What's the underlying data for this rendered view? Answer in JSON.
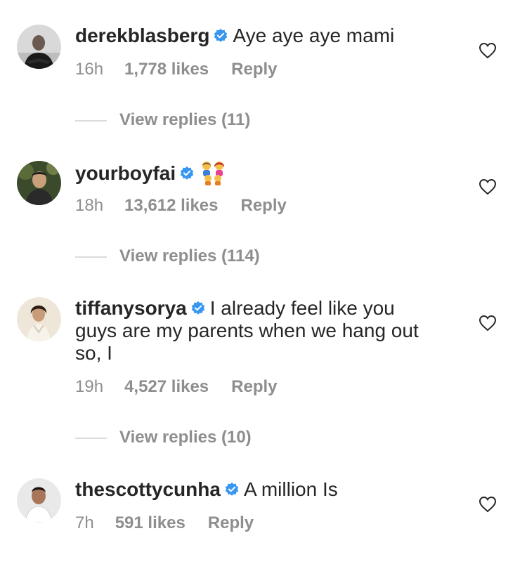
{
  "colors": {
    "verified": "#3897f0",
    "text": "#262626",
    "meta": "#8e8e8e",
    "divider": "#dbdbdb"
  },
  "comments": [
    {
      "username": "derekblasberg",
      "text": "Aye aye aye mami",
      "time": "16h",
      "likes": "1,778 likes",
      "reply": "Reply",
      "view_replies": "View replies (11)"
    },
    {
      "username": "yourboyfai",
      "text": "",
      "emoji": "family-emoji",
      "time": "18h",
      "likes": "13,612 likes",
      "reply": "Reply",
      "view_replies": "View replies (114)"
    },
    {
      "username": "tiffanysorya",
      "text": "I already feel like you guys are my parents when we hang out so, I",
      "time": "19h",
      "likes": "4,527 likes",
      "reply": "Reply",
      "view_replies": "View replies (10)"
    },
    {
      "username": "thescottycunha",
      "text": "A million Is",
      "time": "7h",
      "likes": "591 likes",
      "reply": "Reply"
    }
  ]
}
